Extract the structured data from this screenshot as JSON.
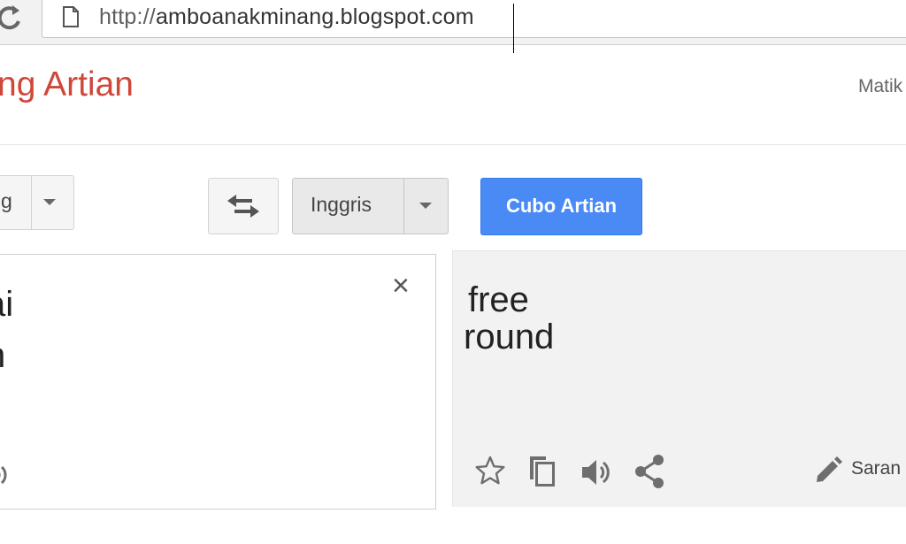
{
  "browser": {
    "url_prefix": "http://",
    "url_host": "amboanakminang.blogspot.com"
  },
  "header": {
    "brand": "ng Artian",
    "signin": "Matik"
  },
  "controls": {
    "source_lang": "g",
    "target_lang": "Inggris",
    "translate_label": "Cubo Artian"
  },
  "source": {
    "text": "ai\nn",
    "clear_glyph": "×"
  },
  "result": {
    "line1": "free",
    "line2": "round",
    "suggest_label": "Saran"
  },
  "colors": {
    "brand": "#d0473a",
    "translate_button": "#4a8af4"
  }
}
